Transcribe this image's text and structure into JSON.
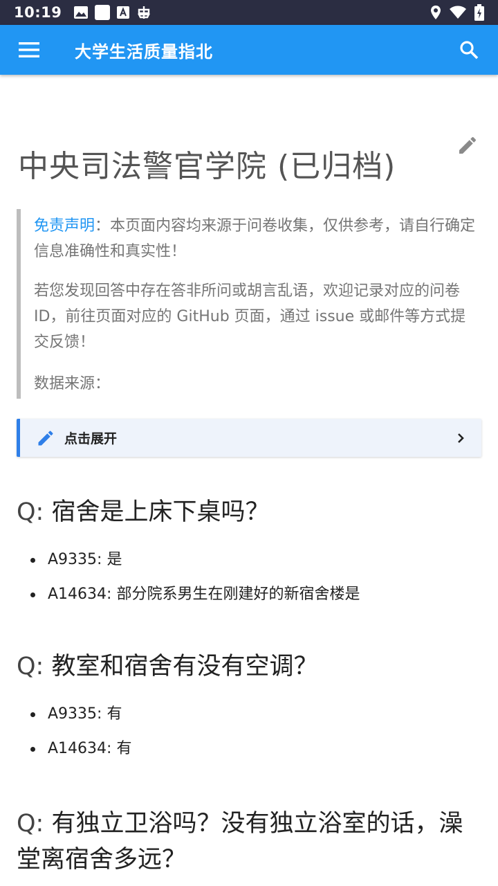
{
  "status_bar": {
    "time": "10:19",
    "left_icons": [
      "image-icon",
      "square-icon",
      "font-icon",
      "bug-icon"
    ],
    "right_icons": [
      "location-icon",
      "wifi-icon",
      "battery-icon"
    ]
  },
  "app_bar": {
    "title": "大学生活质量指北",
    "menu_icon": "menu-icon",
    "search_icon": "search-icon",
    "color": "#2196f3"
  },
  "page": {
    "title": "中央司法警官学院 (已归档)",
    "edit_icon": "edit-icon"
  },
  "notice": {
    "lead": "免责声明",
    "p1_rest": "：本页面内容均来源于问卷收集，仅供参考，请自行确定信息准确性和真实性！",
    "p2": "若您发现回答中存在答非所问或胡言乱语，欢迎记录对应的问卷 ID，前往页面对应的 GitHub 页面，通过 issue 或邮件等方式提交反馈！",
    "p3": "数据来源："
  },
  "expander": {
    "label": "点击展开",
    "icon": "pencil-icon",
    "chevron": "chevron-right-icon"
  },
  "qa": [
    {
      "prefix": "Q:",
      "question": "宿舍是上床下桌吗？",
      "answers": [
        "A9335: 是",
        "A14634: 部分院系男生在刚建好的新宿舍楼是"
      ]
    },
    {
      "prefix": "Q:",
      "question": "教室和宿舍有没有空调？",
      "answers": [
        "A9335: 有",
        "A14634: 有"
      ]
    },
    {
      "prefix": "Q:",
      "question": "有独立卫浴吗？没有独立浴室的话，澡堂离宿舍多远？",
      "answers": []
    }
  ]
}
